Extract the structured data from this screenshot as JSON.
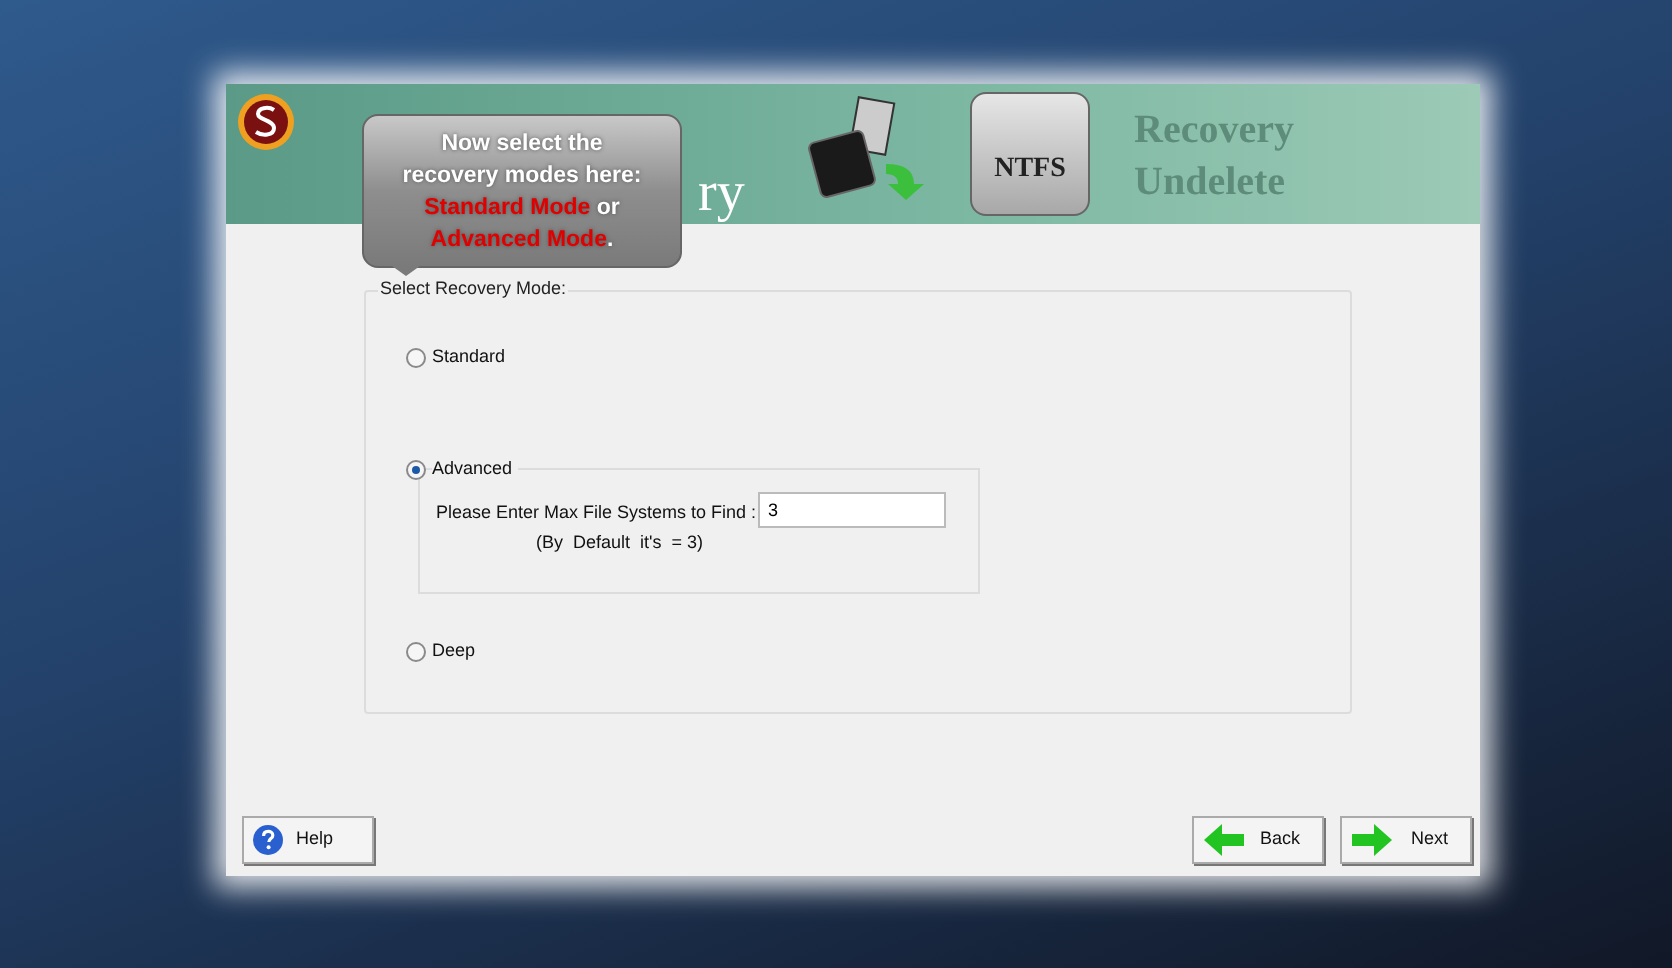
{
  "header": {
    "title_fragment": "ry",
    "faded_lines": [
      "Recovery",
      "Undelete"
    ],
    "badge": "NTFS"
  },
  "callout": {
    "lines": [
      "Now select the",
      "recovery modes here:"
    ],
    "highlights": [
      "Standard Mode",
      "Advanced Mode"
    ],
    "joiner": "or",
    "end": "."
  },
  "group": {
    "legend": "Select Recovery Mode:",
    "options": [
      {
        "label": "Standard",
        "selected": false
      },
      {
        "label": "Advanced",
        "selected": true,
        "field_label": "Please Enter Max File Systems to Find :",
        "field_value": "3",
        "hint": "(By  Default  it's  = 3)"
      },
      {
        "label": "Deep",
        "selected": false
      }
    ]
  },
  "buttons": [
    {
      "label": "Help",
      "kind": "help"
    },
    {
      "label": "Back",
      "kind": "back"
    },
    {
      "label": "Next",
      "kind": "next"
    }
  ]
}
